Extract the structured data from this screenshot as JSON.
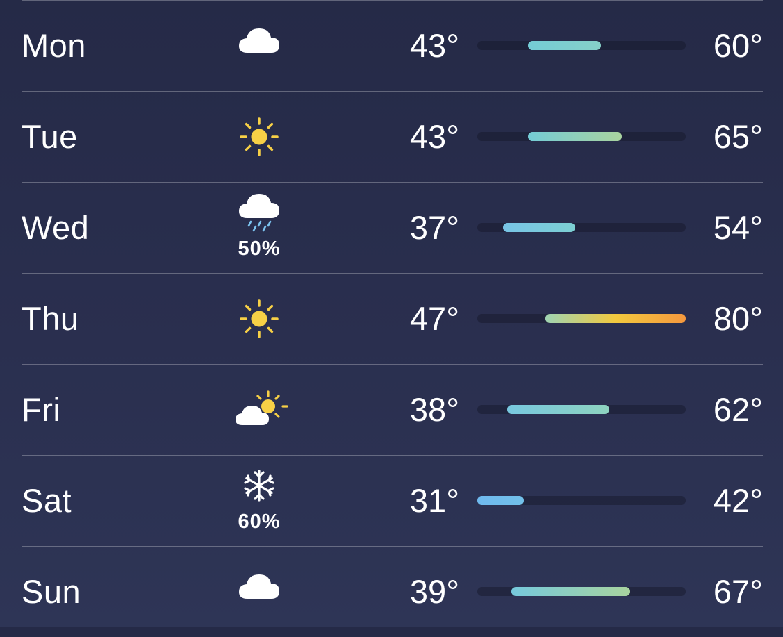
{
  "forecast": {
    "scale_min": 31,
    "scale_max": 80,
    "days": [
      {
        "day": "Mon",
        "icon": "cloud-icon",
        "precip": "",
        "low": "43°",
        "high": "60°",
        "low_val": 43,
        "high_val": 60,
        "colors": [
          "#74ccd6",
          "#86d0c8"
        ]
      },
      {
        "day": "Tue",
        "icon": "sun-icon",
        "precip": "",
        "low": "43°",
        "high": "65°",
        "low_val": 43,
        "high_val": 65,
        "colors": [
          "#74ccd6",
          "#a9d39f"
        ]
      },
      {
        "day": "Wed",
        "icon": "cloud-rain-icon",
        "precip": "50%",
        "low": "37°",
        "high": "54°",
        "low_val": 37,
        "high_val": 54,
        "colors": [
          "#78c4e6",
          "#7ccfd2"
        ]
      },
      {
        "day": "Thu",
        "icon": "sun-icon",
        "precip": "",
        "low": "47°",
        "high": "80°",
        "low_val": 47,
        "high_val": 80,
        "colors": [
          "#9fd4b3",
          "#f2c93e",
          "#f5983e"
        ]
      },
      {
        "day": "Fri",
        "icon": "partly-cloudy-icon",
        "precip": "",
        "low": "38°",
        "high": "62°",
        "low_val": 38,
        "high_val": 62,
        "colors": [
          "#78c8e0",
          "#8ed3bf"
        ]
      },
      {
        "day": "Sat",
        "icon": "snowflake-icon",
        "precip": "60%",
        "low": "31°",
        "high": "42°",
        "low_val": 31,
        "high_val": 42,
        "colors": [
          "#6fb9ee",
          "#72c0ea"
        ]
      },
      {
        "day": "Sun",
        "icon": "cloud-icon",
        "precip": "",
        "low": "39°",
        "high": "67°",
        "low_val": 39,
        "high_val": 67,
        "colors": [
          "#76c9dc",
          "#a8d39e"
        ]
      }
    ]
  }
}
